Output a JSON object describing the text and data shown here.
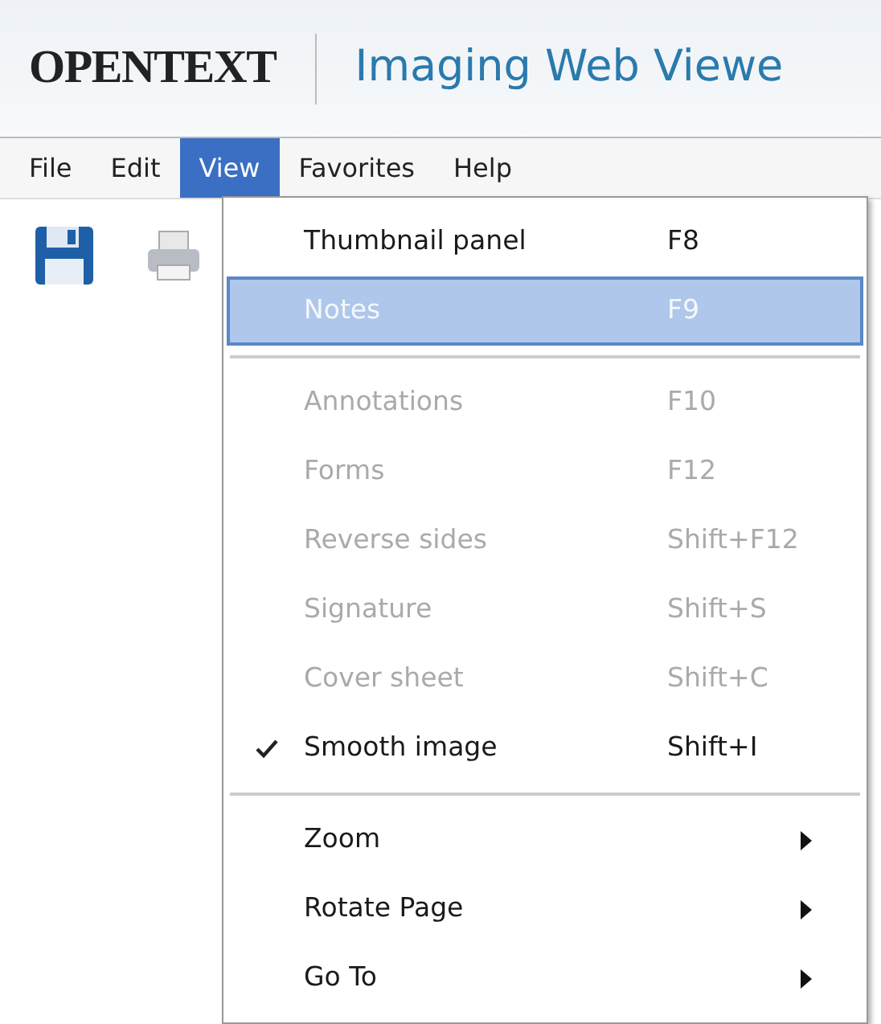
{
  "header": {
    "logo": "OPENTEXT",
    "title": "Imaging Web Viewe"
  },
  "menu_bar": [
    {
      "label": "File",
      "selected": false
    },
    {
      "label": "Edit",
      "selected": false
    },
    {
      "label": "View",
      "selected": true
    },
    {
      "label": "Favorites",
      "selected": false
    },
    {
      "label": "Help",
      "selected": false
    }
  ],
  "toolbar": [
    {
      "kind": "save"
    },
    {
      "kind": "print"
    }
  ],
  "view_menu": {
    "groups": [
      [
        {
          "kind": "command",
          "label": "Thumbnail panel",
          "shortcut": "F8",
          "disabled": false,
          "selected": false,
          "checked": false
        },
        {
          "kind": "command",
          "label": "Notes",
          "shortcut": "F9",
          "disabled": true,
          "selected": true,
          "checked": false
        }
      ],
      [
        {
          "kind": "command",
          "label": "Annotations",
          "shortcut": "F10",
          "disabled": true,
          "selected": false,
          "checked": false
        },
        {
          "kind": "command",
          "label": "Forms",
          "shortcut": "F12",
          "disabled": true,
          "selected": false,
          "checked": false
        },
        {
          "kind": "command",
          "label": "Reverse sides",
          "shortcut": "Shift+F12",
          "disabled": true,
          "selected": false,
          "checked": false
        },
        {
          "kind": "command",
          "label": "Signature",
          "shortcut": "Shift+S",
          "disabled": true,
          "selected": false,
          "checked": false
        },
        {
          "kind": "command",
          "label": "Cover sheet",
          "shortcut": "Shift+C",
          "disabled": true,
          "selected": false,
          "checked": false
        },
        {
          "kind": "command",
          "label": "Smooth image",
          "shortcut": "Shift+I",
          "disabled": false,
          "selected": false,
          "checked": true
        }
      ],
      [
        {
          "kind": "submenu",
          "label": "Zoom",
          "disabled": false,
          "selected": false
        },
        {
          "kind": "submenu",
          "label": "Rotate Page",
          "disabled": false,
          "selected": false
        },
        {
          "kind": "submenu",
          "label": "Go To",
          "disabled": false,
          "selected": false
        }
      ]
    ]
  }
}
